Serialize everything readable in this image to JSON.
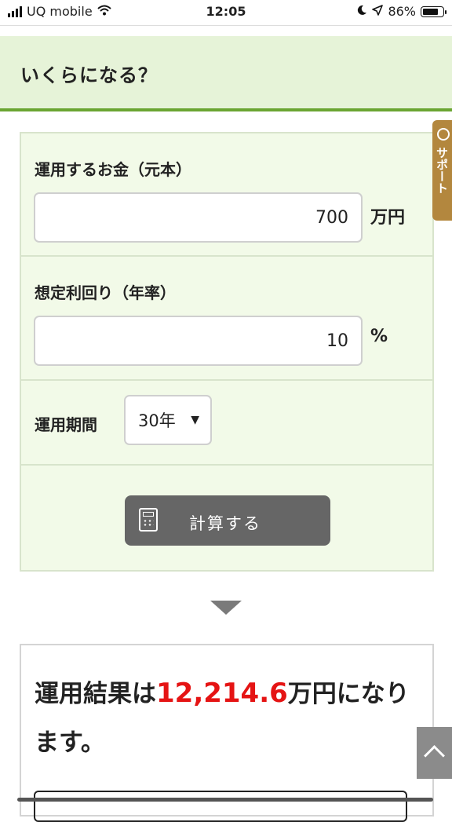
{
  "status_bar": {
    "carrier": "UQ mobile",
    "time": "12:05",
    "battery_percent": "86%",
    "battery_level": 0.86
  },
  "header": {
    "title": "いくらになる？"
  },
  "form": {
    "principal": {
      "label": "運用するお金（元本）",
      "value": "700",
      "unit": "万円"
    },
    "rate": {
      "label": "想定利回り（年率）",
      "value": "10",
      "unit": "%"
    },
    "period": {
      "label": "運用期間",
      "selected": "30年"
    },
    "calculate_label": "計算する"
  },
  "side_tab": {
    "label": "サポート"
  },
  "result": {
    "prefix": "運用結果は",
    "value": "12,214.6",
    "suffix": "万円になります。"
  },
  "colors": {
    "header_bg": "#e6f3d8",
    "header_border": "#6aa532",
    "result_accent": "#e51414",
    "button_bg": "#666666",
    "side_tab_bg": "#b3873e"
  },
  "icons": {
    "calculator": "calculator-icon",
    "scroll_top": "chevron-up-icon",
    "dropdown": "triangle-down-icon"
  }
}
